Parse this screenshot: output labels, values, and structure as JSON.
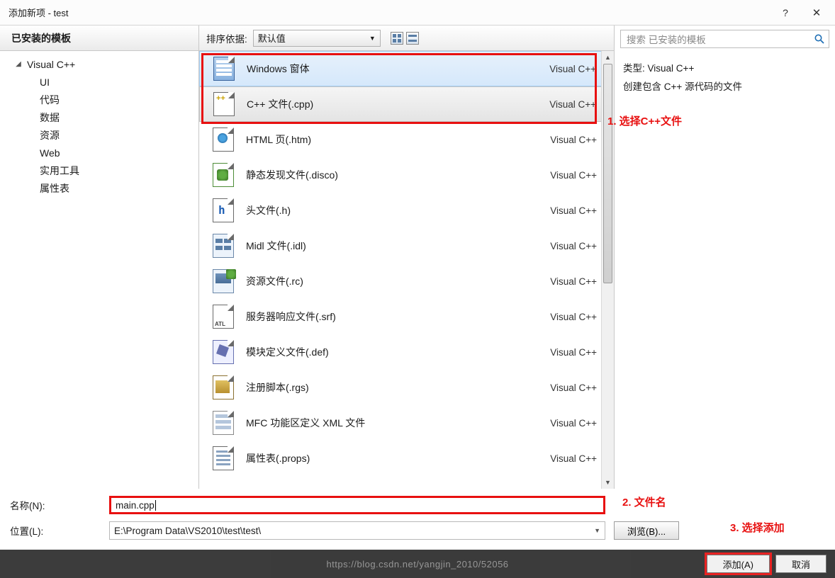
{
  "window": {
    "title": "添加新项 - test",
    "help": "?",
    "close": "✕"
  },
  "left": {
    "header": "已安装的模板",
    "root": "Visual C++",
    "children": [
      "UI",
      "代码",
      "数据",
      "资源",
      "Web",
      "实用工具",
      "属性表"
    ]
  },
  "toolbar": {
    "sort_label": "排序依据:",
    "sort_value": "默认值"
  },
  "items": [
    {
      "label": "Windows 窗体",
      "lang": "Visual C++",
      "icon": "form"
    },
    {
      "label": "C++ 文件(.cpp)",
      "lang": "Visual C++",
      "icon": "cpp"
    },
    {
      "label": "HTML 页(.htm)",
      "lang": "Visual C++",
      "icon": "html"
    },
    {
      "label": "静态发现文件(.disco)",
      "lang": "Visual C++",
      "icon": "disco"
    },
    {
      "label": "头文件(.h)",
      "lang": "Visual C++",
      "icon": "h"
    },
    {
      "label": "Midl 文件(.idl)",
      "lang": "Visual C++",
      "icon": "midl"
    },
    {
      "label": "资源文件(.rc)",
      "lang": "Visual C++",
      "icon": "rc"
    },
    {
      "label": "服务器响应文件(.srf)",
      "lang": "Visual C++",
      "icon": "srf"
    },
    {
      "label": "模块定义文件(.def)",
      "lang": "Visual C++",
      "icon": "def"
    },
    {
      "label": "注册脚本(.rgs)",
      "lang": "Visual C++",
      "icon": "rgs"
    },
    {
      "label": "MFC 功能区定义 XML 文件",
      "lang": "Visual C++",
      "icon": "mfc"
    },
    {
      "label": "属性表(.props)",
      "lang": "Visual C++",
      "icon": "props"
    }
  ],
  "right": {
    "search_placeholder": "搜索 已安装的模板",
    "type_label": "类型:",
    "type_value": "Visual C++",
    "desc": "创建包含 C++ 源代码的文件"
  },
  "annotations": {
    "a1": "1. 选择C++文件",
    "a2": "2. 文件名",
    "a3": "3. 选择添加"
  },
  "bottom": {
    "name_label": "名称(N):",
    "name_value": "main.cpp",
    "loc_label": "位置(L):",
    "loc_value": "E:\\Program Data\\VS2010\\test\\test\\",
    "browse": "浏览(B)..."
  },
  "footer": {
    "add": "添加(A)",
    "cancel": "取消",
    "watermark": "https://blog.csdn.net/yangjin_2010/52056"
  }
}
